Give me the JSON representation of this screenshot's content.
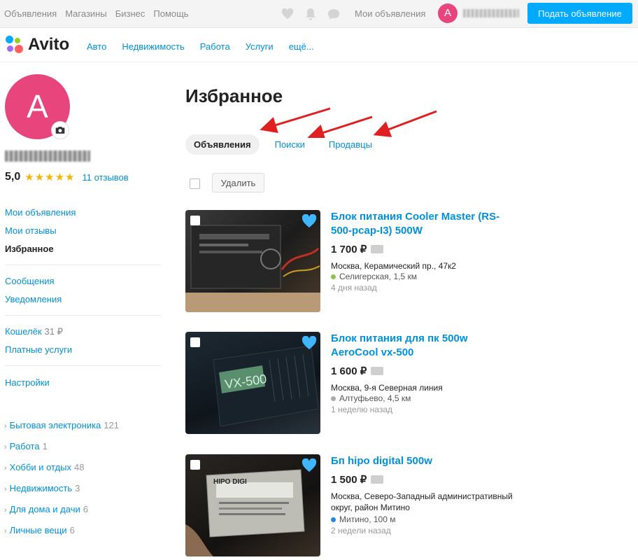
{
  "topbar": {
    "nav": [
      "Объявления",
      "Магазины",
      "Бизнес",
      "Помощь"
    ],
    "my_ads": "Мои объявления",
    "avatar_letter": "А",
    "post_button": "Подать объявление"
  },
  "brand": {
    "name": "Avito",
    "nav": [
      "Авто",
      "Недвижимость",
      "Работа",
      "Услуги",
      "ещё..."
    ]
  },
  "profile": {
    "avatar_letter": "А",
    "rating": "5,0",
    "stars": "★★★★★",
    "reviews": "11 отзывов"
  },
  "sidebar": {
    "my_ads": "Мои объявления",
    "my_reviews": "Мои отзывы",
    "favorites": "Избранное",
    "messages": "Сообщения",
    "notifications": "Уведомления",
    "wallet": "Кошелёк",
    "wallet_value": "31 ₽",
    "paid_services": "Платные услуги",
    "settings": "Настройки",
    "categories": [
      {
        "label": "Бытовая электроника",
        "count": "121"
      },
      {
        "label": "Работа",
        "count": "1"
      },
      {
        "label": "Хобби и отдых",
        "count": "48"
      },
      {
        "label": "Недвижимость",
        "count": "3"
      },
      {
        "label": "Для дома и дачи",
        "count": "6"
      },
      {
        "label": "Личные вещи",
        "count": "6"
      }
    ]
  },
  "main": {
    "title": "Избранное",
    "tabs": [
      "Объявления",
      "Поиски",
      "Продавцы"
    ],
    "delete_button": "Удалить",
    "listings": [
      {
        "title": "Блок питания Cooler Master (RS-500-pcap-I3) 500W",
        "price": "1 700 ₽",
        "address": "Москва, Керамический пр., 47к2",
        "metro": "Селигерская, 1,5 км",
        "metro_color": "#8bc34a",
        "time": "4 дня назад"
      },
      {
        "title": "Блок питания для пк 500w AeroCool vx-500",
        "price": "1 600 ₽",
        "address": "Москва, 9-я Северная линия",
        "metro": "Алтуфьево, 4,5 км",
        "metro_color": "#aaaaaa",
        "time": "1 неделю назад",
        "thumb_text": "VX-500"
      },
      {
        "title": "Бп hipo digital 500w",
        "price": "1 500 ₽",
        "address": "Москва, Северо-Западный административный округ, район Митино",
        "metro": "Митино, 100 м",
        "metro_color": "#1e88e5",
        "time": "2 недели назад",
        "thumb_text": "HIPO DIGI"
      }
    ]
  },
  "colors": {
    "accent": "#0091d9",
    "primary_button": "#00aaff",
    "avatar": "#e8457c",
    "arrow": "#e02020"
  }
}
